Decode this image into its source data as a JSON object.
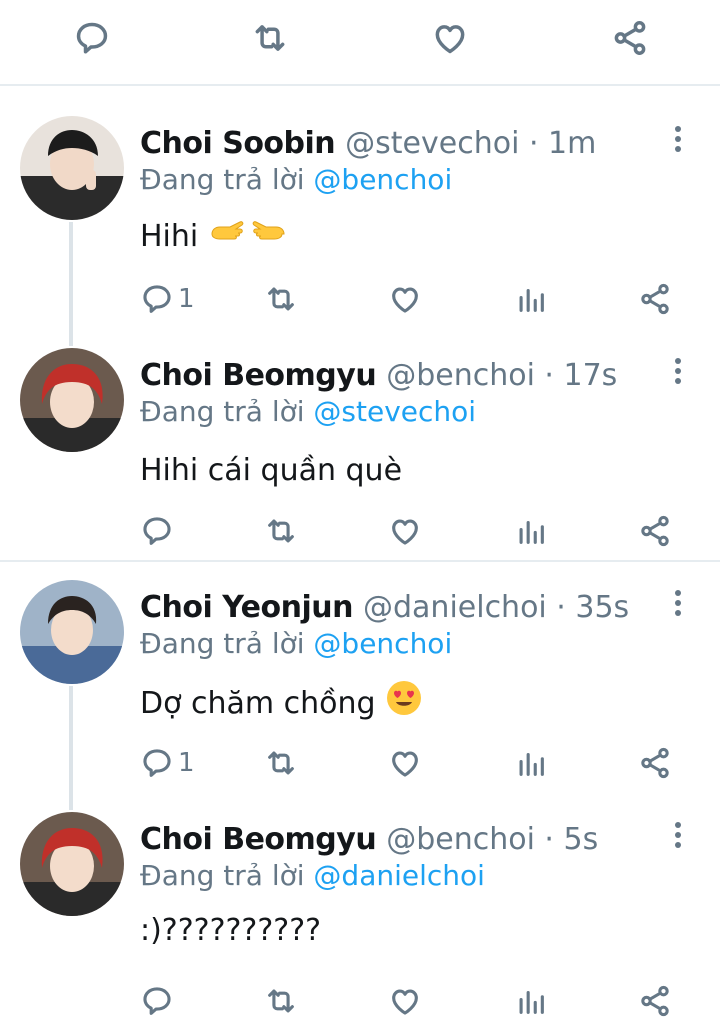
{
  "top_actions": [
    "reply-icon",
    "retweet-icon",
    "like-icon",
    "share-icon"
  ],
  "tweets": [
    {
      "name": "Choi Soobin",
      "meta": "@stevechoi · 1m",
      "reply_prefix": "Đang trả lời ",
      "reply_to": "@benchoi",
      "text": "Hihi",
      "emoji": "pointing-hands",
      "reply_count": "1",
      "avatar_color": "#d9d2cc"
    },
    {
      "name": "Choi Beomgyu",
      "meta": "@benchoi · 17s",
      "reply_prefix": "Đang trả lời ",
      "reply_to": "@stevechoi",
      "text": "Hihi cái quần què",
      "reply_count": "",
      "avatar_color": "#b8322c"
    },
    {
      "name": "Choi Yeonjun",
      "meta": "@danielchoi · 35s",
      "reply_prefix": "Đang trả lời ",
      "reply_to": "@benchoi",
      "text": "Dợ chăm chồng",
      "emoji": "heart-eyes",
      "reply_count": "1",
      "avatar_color": "#4f6f9c"
    },
    {
      "name": "Choi Beomgyu",
      "meta": "@benchoi · 5s",
      "reply_prefix": "Đang trả lời ",
      "reply_to": "@danielchoi",
      "text": ":)??????????",
      "reply_count": "",
      "avatar_color": "#b8322c"
    }
  ],
  "colors": {
    "link": "#1da1f2",
    "muted": "#657786",
    "divider": "#e6ecf0"
  }
}
